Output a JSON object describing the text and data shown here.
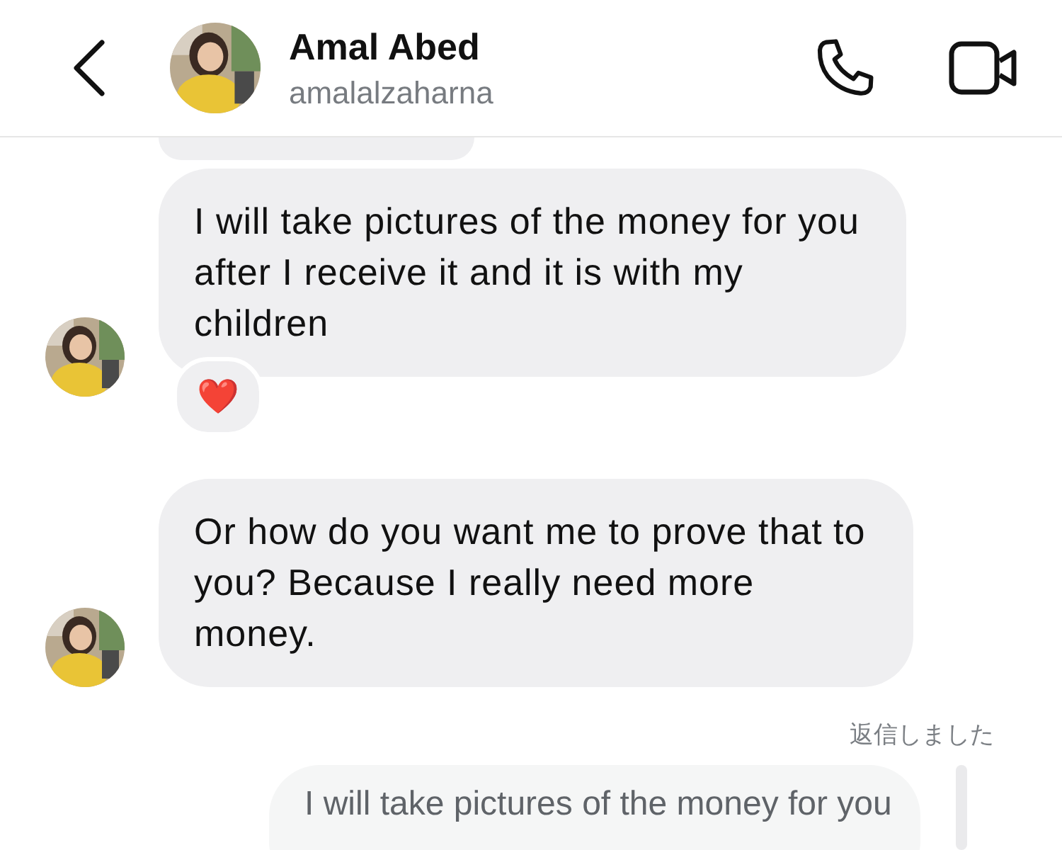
{
  "header": {
    "name": "Amal Abed",
    "username": "amalalzaharna"
  },
  "messages": [
    {
      "kind": "cut"
    },
    {
      "kind": "incoming",
      "text": "I will take pictures of the money for you after I receive it and it is with my children",
      "reaction": "❤️"
    },
    {
      "kind": "incoming",
      "text": "Or how do you want me to prove that to you? Because I really need more money."
    }
  ],
  "reply": {
    "label": "返信しました",
    "quote": "I will take pictures of the money for you"
  }
}
